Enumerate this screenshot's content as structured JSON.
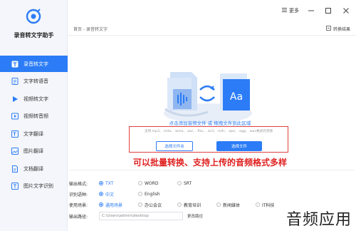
{
  "app": {
    "title": "录音转文字助手"
  },
  "sidebar": {
    "items": [
      {
        "label": "录音转文字",
        "icon": "t-text-icon",
        "active": true
      },
      {
        "label": "文字转语音",
        "icon": "doc-text-icon",
        "active": false
      },
      {
        "label": "视频转文字",
        "icon": "video-play-icon",
        "active": false
      },
      {
        "label": "视频转音频",
        "icon": "video-audio-icon",
        "active": false
      },
      {
        "label": "文字翻译",
        "icon": "translate-icon",
        "active": false
      },
      {
        "label": "图片翻译",
        "icon": "image-translate-icon",
        "active": false
      },
      {
        "label": "文档翻译",
        "icon": "document-translate-icon",
        "active": false
      },
      {
        "label": "图片文字识别",
        "icon": "ocr-icon",
        "active": false
      }
    ]
  },
  "topbar": {
    "more_label": "更多"
  },
  "breadcrumb": {
    "text": "首页 - 录音转文字"
  },
  "convert_result": {
    "label": "转换结果"
  },
  "drop": {
    "hint": "点击添加音频文件 或 拖拽文件到此区域",
    "formats": "支持.mp3、.m4a、.wma、.aac、.flac、.ac3、.m4r、.ape、.ogg、.wav格式的音频",
    "folder_button": "选择文件夹",
    "file_button": "选择文件",
    "illustration_badge": "Aa"
  },
  "annotation": "可以批量转换、支持上传的音频格式多样",
  "settings": {
    "output_format": {
      "label": "输出格式:",
      "options": [
        "TXT",
        "WORD",
        "SRT"
      ],
      "selected": "TXT"
    },
    "language": {
      "label": "识别语种:",
      "options": [
        "中文",
        "English"
      ],
      "selected": "中文"
    },
    "scene": {
      "label": "使用场景:",
      "options": [
        "通用场景",
        "办公会议",
        "教育培训",
        "新闻媒体",
        "IT科技"
      ],
      "selected": "通用场景"
    },
    "output_path": {
      "label": "输出路径:",
      "value": "C:\\Users\\admin\\desktop",
      "change_label": "更改路径"
    }
  },
  "watermark": "音频应用",
  "colors": {
    "accent": "#2b7cf6",
    "annotation": "#e02020",
    "sidebar_bg": "#f4f6fb"
  }
}
